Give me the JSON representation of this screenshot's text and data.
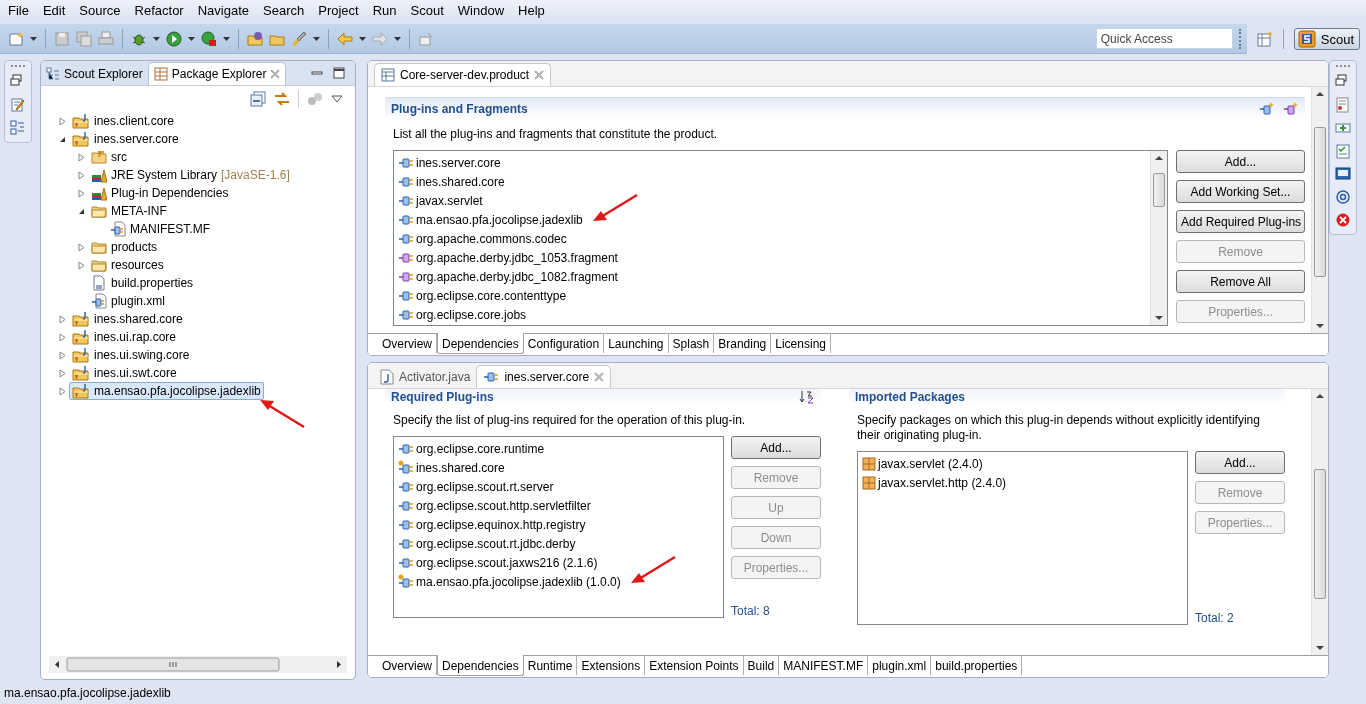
{
  "menu": [
    "File",
    "Edit",
    "Source",
    "Refactor",
    "Navigate",
    "Search",
    "Project",
    "Run",
    "Scout",
    "Window",
    "Help"
  ],
  "toolbar": {
    "quick_access": {
      "placeholder": "Quick Access"
    },
    "perspective": {
      "label": "Scout",
      "selected": true
    }
  },
  "explorer": {
    "tabs": [
      {
        "label": "Scout Explorer",
        "selected": false
      },
      {
        "label": "Package Explorer",
        "selected": true
      }
    ],
    "tree": [
      {
        "label": "ines.client.core",
        "kind": "project",
        "expanded": false,
        "selected": false,
        "marked": false
      },
      {
        "label": "ines.server.core",
        "kind": "project",
        "expanded": true,
        "selected": false,
        "marked": false,
        "children": [
          {
            "label": "src",
            "kind": "source-folder",
            "expanded": false,
            "selected": false,
            "marked": false
          },
          {
            "label": "JRE System Library",
            "decoration": "[JavaSE-1.6]",
            "kind": "library",
            "expanded": false,
            "selected": false,
            "marked": false
          },
          {
            "label": "Plug-in Dependencies",
            "kind": "library",
            "expanded": false,
            "selected": false,
            "marked": false
          },
          {
            "label": "META-INF",
            "kind": "folder",
            "expanded": true,
            "selected": false,
            "marked": false,
            "children": [
              {
                "label": "MANIFEST.MF",
                "kind": "manifest",
                "selected": false,
                "marked": false
              }
            ]
          },
          {
            "label": "products",
            "kind": "folder",
            "expanded": false,
            "selected": false,
            "marked": false
          },
          {
            "label": "resources",
            "kind": "folder",
            "expanded": false,
            "selected": false,
            "marked": false
          },
          {
            "label": "build.properties",
            "kind": "properties",
            "selected": false,
            "marked": false
          },
          {
            "label": "plugin.xml",
            "kind": "xml",
            "selected": false,
            "marked": false
          }
        ]
      },
      {
        "label": "ines.shared.core",
        "kind": "project",
        "expanded": false,
        "selected": false,
        "marked": false
      },
      {
        "label": "ines.ui.rap.core",
        "kind": "project",
        "expanded": false,
        "selected": false,
        "marked": false
      },
      {
        "label": "ines.ui.swing.core",
        "kind": "project",
        "expanded": false,
        "selected": false,
        "marked": false
      },
      {
        "label": "ines.ui.swt.core",
        "kind": "project",
        "expanded": false,
        "selected": false,
        "marked": false
      },
      {
        "label": "ma.ensao.pfa.jocolipse.jadexlib",
        "kind": "project",
        "expanded": false,
        "selected": true,
        "marked": true
      }
    ]
  },
  "product_editor": {
    "tab": {
      "title": "Core-server-dev.product"
    },
    "section": {
      "title": "Plug-ins and Fragments",
      "description": "List all the plug-ins and fragments that constitute the product.",
      "items": [
        {
          "label": "ines.server.core",
          "kind": "plugin",
          "marked": false
        },
        {
          "label": "ines.shared.core",
          "kind": "plugin",
          "marked": false
        },
        {
          "label": "javax.servlet",
          "kind": "plugin",
          "marked": false
        },
        {
          "label": "ma.ensao.pfa.jocolipse.jadexlib",
          "kind": "plugin",
          "marked": true
        },
        {
          "label": "org.apache.commons.codec",
          "kind": "plugin",
          "marked": false
        },
        {
          "label": "org.apache.derby.jdbc_1053.fragment",
          "kind": "fragment",
          "marked": false
        },
        {
          "label": "org.apache.derby.jdbc_1082.fragment",
          "kind": "fragment",
          "marked": false
        },
        {
          "label": "org.eclipse.core.contenttype",
          "kind": "plugin",
          "marked": false
        },
        {
          "label": "org.eclipse.core.jobs",
          "kind": "plugin",
          "marked": false
        }
      ],
      "buttons": [
        {
          "label": "Add...",
          "disabled": false
        },
        {
          "label": "Add Working Set...",
          "disabled": false
        },
        {
          "label": "Add Required Plug-ins",
          "disabled": false
        },
        {
          "label": "Remove",
          "disabled": true
        },
        {
          "label": "Remove All",
          "disabled": false
        },
        {
          "label": "Properties...",
          "disabled": true
        }
      ]
    },
    "page_tabs": [
      {
        "label": "Overview",
        "selected": false
      },
      {
        "label": "Dependencies",
        "selected": true
      },
      {
        "label": "Configuration",
        "selected": false
      },
      {
        "label": "Launching",
        "selected": false
      },
      {
        "label": "Splash",
        "selected": false
      },
      {
        "label": "Branding",
        "selected": false
      },
      {
        "label": "Licensing",
        "selected": false
      }
    ]
  },
  "plugin_editor": {
    "tabs": [
      {
        "title": "Activator.java",
        "kind": "java",
        "selected": false
      },
      {
        "title": "ines.server.core",
        "kind": "plugin",
        "selected": true
      }
    ],
    "required": {
      "title": "Required Plug-ins",
      "description": "Specify the list of plug-ins required for the operation of this plug-in.",
      "items": [
        {
          "label": "org.eclipse.core.runtime",
          "kind": "plugin",
          "marked": false
        },
        {
          "label": "ines.shared.core",
          "kind": "workspace-plugin",
          "marked": false
        },
        {
          "label": "org.eclipse.scout.rt.server",
          "kind": "plugin",
          "marked": false
        },
        {
          "label": "org.eclipse.scout.http.servletfilter",
          "kind": "plugin",
          "marked": false
        },
        {
          "label": "org.eclipse.equinox.http.registry",
          "kind": "plugin",
          "marked": false
        },
        {
          "label": "org.eclipse.scout.rt.jdbc.derby",
          "kind": "plugin",
          "marked": false
        },
        {
          "label": "org.eclipse.scout.jaxws216 (2.1.6)",
          "kind": "plugin",
          "marked": false
        },
        {
          "label": "ma.ensao.pfa.jocolipse.jadexlib (1.0.0)",
          "kind": "workspace-plugin",
          "marked": true
        }
      ],
      "buttons": [
        {
          "label": "Add...",
          "disabled": false
        },
        {
          "label": "Remove",
          "disabled": true
        },
        {
          "label": "Up",
          "disabled": true
        },
        {
          "label": "Down",
          "disabled": true
        },
        {
          "label": "Properties...",
          "disabled": true
        }
      ],
      "total": "Total: 8"
    },
    "imported": {
      "title": "Imported Packages",
      "description": "Specify packages on which this plug-in depends without explicitly identifying their originating plug-in.",
      "items": [
        {
          "label": "javax.servlet (2.4.0)",
          "kind": "package",
          "marked": false
        },
        {
          "label": "javax.servlet.http (2.4.0)",
          "kind": "package",
          "marked": false
        }
      ],
      "buttons": [
        {
          "label": "Add...",
          "disabled": false
        },
        {
          "label": "Remove",
          "disabled": true
        },
        {
          "label": "Properties...",
          "disabled": true
        }
      ],
      "total": "Total: 2"
    },
    "page_tabs": [
      {
        "label": "Overview",
        "selected": false
      },
      {
        "label": "Dependencies",
        "selected": true
      },
      {
        "label": "Runtime",
        "selected": false
      },
      {
        "label": "Extensions",
        "selected": false
      },
      {
        "label": "Extension Points",
        "selected": false
      },
      {
        "label": "Build",
        "selected": false
      },
      {
        "label": "MANIFEST.MF",
        "selected": false
      },
      {
        "label": "plugin.xml",
        "selected": false
      },
      {
        "label": "build.properties",
        "selected": false
      }
    ]
  },
  "status_bar": "ma.ensao.pfa.jocolipse.jadexlib"
}
